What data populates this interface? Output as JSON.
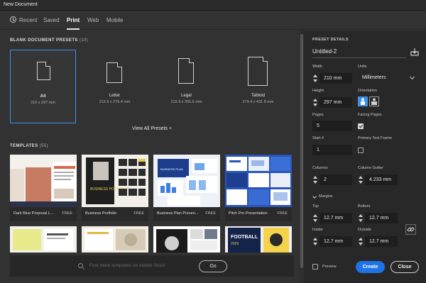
{
  "window": {
    "title": "New Document"
  },
  "tabs": [
    {
      "label": "Recent"
    },
    {
      "label": "Saved"
    },
    {
      "label": "Print"
    },
    {
      "label": "Web"
    },
    {
      "label": "Mobile"
    }
  ],
  "active_tab": "Print",
  "blank_presets": {
    "heading": "BLANK DOCUMENT PRESETS",
    "count": "(10)",
    "items": [
      {
        "name": "A4",
        "size": "210 x 297 mm"
      },
      {
        "name": "Letter",
        "size": "215.9 x 279.4 mm"
      },
      {
        "name": "Legal",
        "size": "215.9 x 355.6 mm"
      },
      {
        "name": "Tabloid",
        "size": "279.4 x 431.8 mm"
      }
    ],
    "selected": "A4",
    "view_all": "View All Presets +"
  },
  "templates": {
    "heading": "TEMPLATES",
    "count": "(55)",
    "items": [
      {
        "name": "Dark Blue Proposal L...",
        "badge": "FREE"
      },
      {
        "name": "Business Portfolio",
        "badge": "FREE"
      },
      {
        "name": "Business Plan Presen...",
        "badge": "FREE"
      },
      {
        "name": "Pitch Pro Presentation",
        "badge": "FREE"
      }
    ],
    "thumb_text": {
      "proposal": "BUSINESS PROPOSAL",
      "portfolio": "BUSINESS PORTFOLIO",
      "plan": "BUSINESS PLAN",
      "football": "FOOTBALL",
      "year": "2029"
    }
  },
  "stock_search": {
    "placeholder": "Find more templates on Adobe Stock",
    "go_label": "Go"
  },
  "preset_details": {
    "heading": "PRESET DETAILS",
    "name": "Untitled-2",
    "width_label": "Width",
    "width": "210 mm",
    "units_label": "Units",
    "units": "Millimeters",
    "height_label": "Height",
    "height": "297 mm",
    "orientation_label": "Orientation",
    "pages_label": "Pages",
    "pages": "5",
    "facing_pages_label": "Facing Pages",
    "facing_pages": true,
    "start_label": "Start #",
    "start": "1",
    "primary_text_frame_label": "Primary Text Frame",
    "primary_text_frame": false,
    "columns_label": "Columns",
    "columns": "2",
    "column_gutter_label": "Column Gutter",
    "column_gutter": "4.233 mm",
    "margins_label": "Margins",
    "top_label": "Top",
    "top": "12.7 mm",
    "bottom_label": "Bottom",
    "bottom": "12.7 mm",
    "inside_label": "Inside",
    "inside": "12.7 mm",
    "outside_label": "Outside",
    "outside": "12.7 mm"
  },
  "footer": {
    "preview_label": "Preview",
    "create_label": "Create",
    "close_label": "Close"
  },
  "colors": {
    "accent": "#1e73e8",
    "selection": "#3d8fe8",
    "background": "#323232",
    "panel": "#282828"
  }
}
